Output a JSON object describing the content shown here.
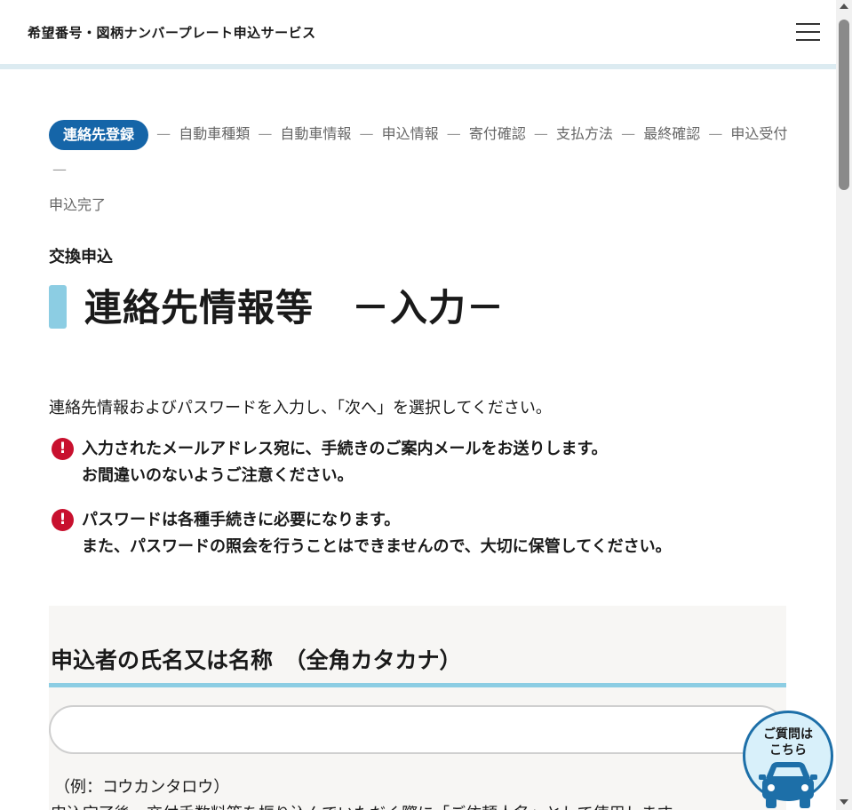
{
  "header": {
    "title": "希望番号・図柄ナンバープレート申込サービス"
  },
  "steps": {
    "items": [
      "連絡先登録",
      "自動車種類",
      "自動車情報",
      "申込情報",
      "寄付確認",
      "支払方法",
      "最終確認",
      "申込受付",
      "申込完了"
    ],
    "separator": "—"
  },
  "page": {
    "subtitle": "交換申込",
    "title": "連絡先情報等　－入力－",
    "intro": "連絡先情報およびパスワードを入力し、「次へ」を選択してください。"
  },
  "notices": [
    {
      "line1": "入力されたメールアドレス宛に、手続きのご案内メールをお送りします。",
      "line2": "お間違いのないようご注意ください。"
    },
    {
      "line1": "パスワードは各種手続きに必要になります。",
      "line2": "また、パスワードの照会を行うことはできませんので、大切に保管してください。"
    }
  ],
  "form": {
    "name_label": "申込者の氏名又は名称　（全角カタカナ）",
    "name_value": "",
    "example": "（例：コウカンタロウ）",
    "note": "申込完了後、交付手数料等を振り込んでいただく際に「ご依頼人名」として使用します。"
  },
  "help": {
    "line1": "ご質問は",
    "line2": "こちら"
  },
  "colors": {
    "accent": "#1565a8",
    "title_bar": "#8ccde3",
    "alert": "#c8102e",
    "section_bg": "#f7f6f4"
  }
}
